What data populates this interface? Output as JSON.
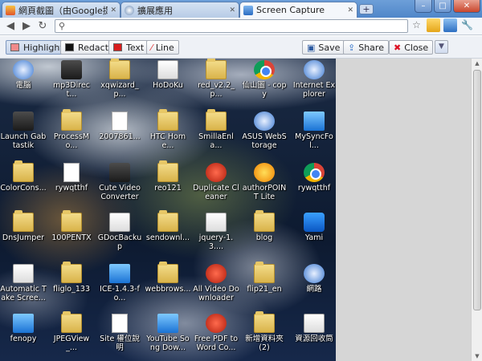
{
  "tabs": [
    {
      "title": "網頁截圖（由Google提供）",
      "favicon": "screenshot-icon",
      "active": false
    },
    {
      "title": "擴展應用",
      "favicon": "puzzle-icon",
      "active": false
    },
    {
      "title": "Screen Capture",
      "favicon": "camera-icon",
      "active": true
    }
  ],
  "window": {
    "minimize": "–",
    "maximize": "□",
    "close": "✕"
  },
  "omnibox": {
    "value": "",
    "placeholder": ""
  },
  "toolbar": {
    "highlight": "Highlight",
    "redact": "Redact",
    "text": "Text",
    "line": "Line",
    "save": "Save",
    "share": "Share",
    "close": "Close"
  },
  "colors": {
    "highlight": "#f08a8a",
    "redact": "#111111",
    "text": "#d81e1e",
    "line": "#e03030"
  },
  "desktop_icons": [
    {
      "label": "電腦",
      "icon": "computer-icon",
      "style": "app1"
    },
    {
      "label": "mp3Direct...",
      "icon": "mp3-icon",
      "style": "app2"
    },
    {
      "label": "xqwizard_p...",
      "icon": "folder-icon",
      "style": "folder"
    },
    {
      "label": "HoDoKu",
      "icon": "sudoku-icon",
      "style": "app4"
    },
    {
      "label": "red_v2.2_p...",
      "icon": "folder-icon",
      "style": "folder"
    },
    {
      "label": "仙山圖 - copy",
      "icon": "chrome-icon",
      "style": "chrome"
    },
    {
      "label": "Internet Explorer",
      "icon": "ie-icon",
      "style": "app1"
    },
    {
      "label": "Launch Gabtastik",
      "icon": "gabtastik-icon",
      "style": "app2"
    },
    {
      "label": "ProcessMo...",
      "icon": "folder-icon",
      "style": "folder"
    },
    {
      "label": "2007861...",
      "icon": "mp3-file-icon",
      "style": "doc"
    },
    {
      "label": "HTC Home...",
      "icon": "folder-icon",
      "style": "folder"
    },
    {
      "label": "SmillaEnla...",
      "icon": "folder-icon",
      "style": "folder"
    },
    {
      "label": "ASUS WebStorage",
      "icon": "asus-icon",
      "style": "app1"
    },
    {
      "label": "MySyncFol...",
      "icon": "sync-icon",
      "style": "app7"
    },
    {
      "label": "ColorCons...",
      "icon": "folder-icon",
      "style": "folder"
    },
    {
      "label": "rywqtthf",
      "icon": "document-icon",
      "style": "doc"
    },
    {
      "label": "Cute Video Converter",
      "icon": "video-icon",
      "style": "app2"
    },
    {
      "label": "reo121",
      "icon": "folder-icon",
      "style": "folder"
    },
    {
      "label": "Duplicate Cleaner",
      "icon": "cleaner-icon",
      "style": "app3"
    },
    {
      "label": "authorPOINT Lite",
      "icon": "authorpoint-icon",
      "style": "app6"
    },
    {
      "label": "rywqtthf",
      "icon": "chrome-icon",
      "style": "chrome"
    },
    {
      "label": "DnsJumper",
      "icon": "folder-icon",
      "style": "folder"
    },
    {
      "label": "100PENTX",
      "icon": "folder-icon",
      "style": "folder"
    },
    {
      "label": "GDocBackup",
      "icon": "gdoc-icon",
      "style": "app4"
    },
    {
      "label": "sendownl...",
      "icon": "folder-icon",
      "style": "folder"
    },
    {
      "label": "jquery-1.3....",
      "icon": "js-icon",
      "style": "app4"
    },
    {
      "label": "blog",
      "icon": "folder-icon",
      "style": "folder"
    },
    {
      "label": "Yami",
      "icon": "music-icon",
      "style": "app5"
    },
    {
      "label": "Automatic Take Scree...",
      "icon": "clock-icon",
      "style": "app4"
    },
    {
      "label": "fliglo_133",
      "icon": "folder-icon",
      "style": "folder"
    },
    {
      "label": "ICE-1.4.3-fo...",
      "icon": "ice-icon",
      "style": "app7"
    },
    {
      "label": "webbrows...",
      "icon": "folder-icon",
      "style": "folder"
    },
    {
      "label": "All Video Downloader",
      "icon": "downloader-icon",
      "style": "app3"
    },
    {
      "label": "flip21_en",
      "icon": "folder-icon",
      "style": "folder"
    },
    {
      "label": "網路",
      "icon": "network-icon",
      "style": "app1"
    },
    {
      "label": "fenopy",
      "icon": "python-icon",
      "style": "app7"
    },
    {
      "label": "JPEGView_...",
      "icon": "folder-icon",
      "style": "folder"
    },
    {
      "label": "Site 權位說明",
      "icon": "document-icon",
      "style": "doc"
    },
    {
      "label": "YouTube Song Dow...",
      "icon": "youtube-icon",
      "style": "app7"
    },
    {
      "label": "Free PDF to Word Co...",
      "icon": "pdf-icon",
      "style": "app3"
    },
    {
      "label": "新增資料夾 (2)",
      "icon": "folder-icon",
      "style": "folder"
    },
    {
      "label": "資源回收筒",
      "icon": "recycle-bin-icon",
      "style": "app4"
    }
  ]
}
